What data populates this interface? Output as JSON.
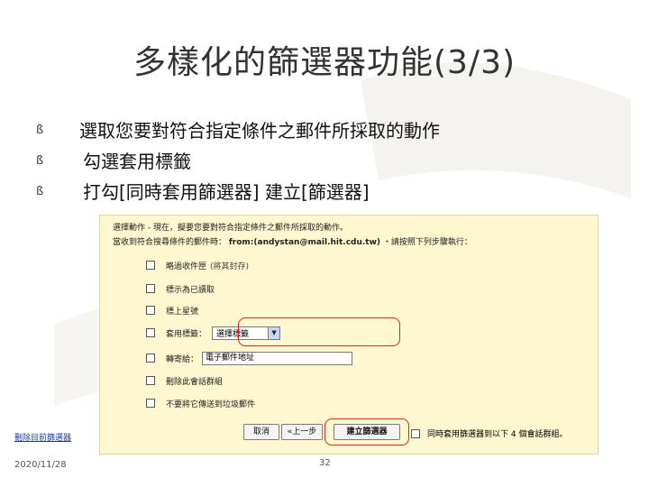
{
  "slide": {
    "title": "多樣化的篩選器功能(3/3)",
    "bullets": [
      {
        "mark": "ß",
        "text": "選取您要對符合指定條件之郵件所採取的動作"
      },
      {
        "mark": "ß",
        "text": "勾選套用標籤"
      },
      {
        "mark": "ß",
        "text": "打勾[同時套用篩選器] 建立[篩選器]"
      }
    ],
    "footer_date": "2020/11/28",
    "page_number": "32"
  },
  "filter_panel": {
    "header_line1": "選擇動作 - 現在，擬要您要對符合指定條件之郵件所採取的動作。",
    "header_line2_prefix": "當收到符合搜尋條件的郵件時：",
    "header_line2_query": "from:(andystan@mail.hit.cdu.tw)",
    "header_line2_suffix": "・請按照下列步驟執行：",
    "options": [
      {
        "label": "略過收件匣",
        "note": "(將其封存)",
        "checked": false
      },
      {
        "label": "標示為已讀取",
        "note": "",
        "checked": false
      },
      {
        "label": "標上星號",
        "note": "",
        "checked": false
      },
      {
        "label": "套用標籤：",
        "note": "",
        "checked": false,
        "select_value": "選擇標籤"
      },
      {
        "label": "轉寄給：",
        "note": "",
        "checked": false,
        "input_value": "電子郵件地址"
      },
      {
        "label": "刪除此會話群組",
        "note": "",
        "checked": false
      },
      {
        "label": "不要將它傳送到垃圾郵件",
        "note": "",
        "checked": false
      }
    ],
    "delete_link": "刪除目前篩選器",
    "cancel_button": "取消",
    "back_button": "«上一步",
    "create_button": "建立篩選器",
    "also_apply_label": "同時套用篩選器到以下 4 個會話群組。"
  }
}
